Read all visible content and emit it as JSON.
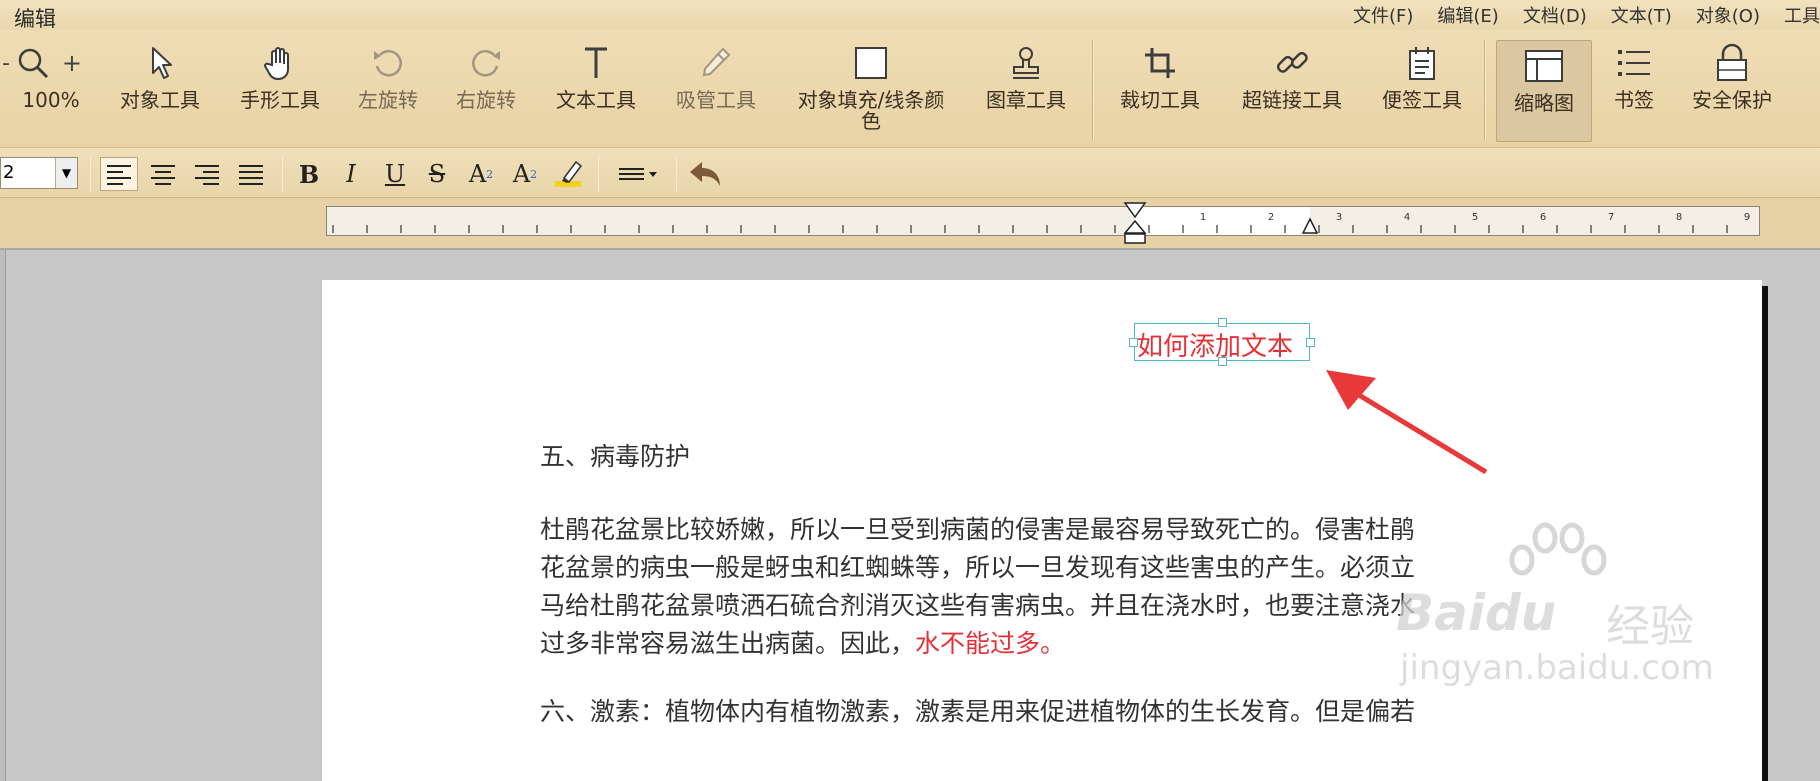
{
  "app": {
    "title": "编辑",
    "menu": [
      "文件(F)",
      "编辑(E)",
      "文档(D)",
      "文本(T)",
      "对象(O)",
      "工具"
    ]
  },
  "toolbar": {
    "zoom_label": "100%",
    "tools": [
      {
        "label": "对象工具",
        "icon": "pointer-icon"
      },
      {
        "label": "手形工具",
        "icon": "hand-icon"
      },
      {
        "label": "左旋转",
        "icon": "rotate-left-icon"
      },
      {
        "label": "右旋转",
        "icon": "rotate-right-icon"
      },
      {
        "label": "文本工具",
        "icon": "text-tool-icon"
      },
      {
        "label": "吸管工具",
        "icon": "eyedropper-icon"
      },
      {
        "label_line1": "对象填充/线条颜",
        "label_line2": "色",
        "icon": "fill-color-icon"
      },
      {
        "label": "图章工具",
        "icon": "stamp-icon"
      },
      {
        "label": "裁切工具",
        "icon": "crop-icon"
      },
      {
        "label": "超链接工具",
        "icon": "link-icon"
      },
      {
        "label": "便签工具",
        "icon": "note-icon"
      },
      {
        "label": "缩略图",
        "icon": "thumbnail-icon"
      },
      {
        "label": "书签",
        "icon": "bookmark-list-icon"
      },
      {
        "label": "安全保护",
        "icon": "lock-icon"
      }
    ]
  },
  "format": {
    "font_size": "2",
    "bold": "B",
    "italic": "I",
    "underline": "U",
    "strike": "S",
    "superscript": "A",
    "superscript_mark": "2",
    "subscript": "A",
    "subscript_mark": "2"
  },
  "ruler": {
    "numbers": [
      "1",
      "2",
      "3",
      "4",
      "5",
      "6",
      "7",
      "8",
      "9"
    ]
  },
  "document": {
    "textbox": "如何添加文本",
    "heading": "五、病毒防护",
    "lines": [
      "杜鹃花盆景比较娇嫩，所以一旦受到病菌的侵害是最容易导致死亡的。侵害杜鹃",
      "花盆景的病虫一般是蚜虫和红蜘蛛等，所以一旦发现有这些害虫的产生。必须立",
      "马给杜鹃花盆景喷洒石硫合剂消灭这些有害病虫。并且在浇水时，也要注意浇水"
    ],
    "line4_normal": "过多非常容易滋生出病菌。因此，",
    "line4_red": "水不能过多。",
    "line5": "六、激素：植物体内有植物激素，激素是用来促进植物体的生长发育。但是偏若"
  },
  "watermark": {
    "brand": "Baidu",
    "brand_cn": "经验",
    "url": "jingyan.baidu.com"
  },
  "colors": {
    "accent_red": "#e5323a",
    "selection_cyan": "#56b6c9",
    "toolbar_bg": "#ecd9ae"
  }
}
